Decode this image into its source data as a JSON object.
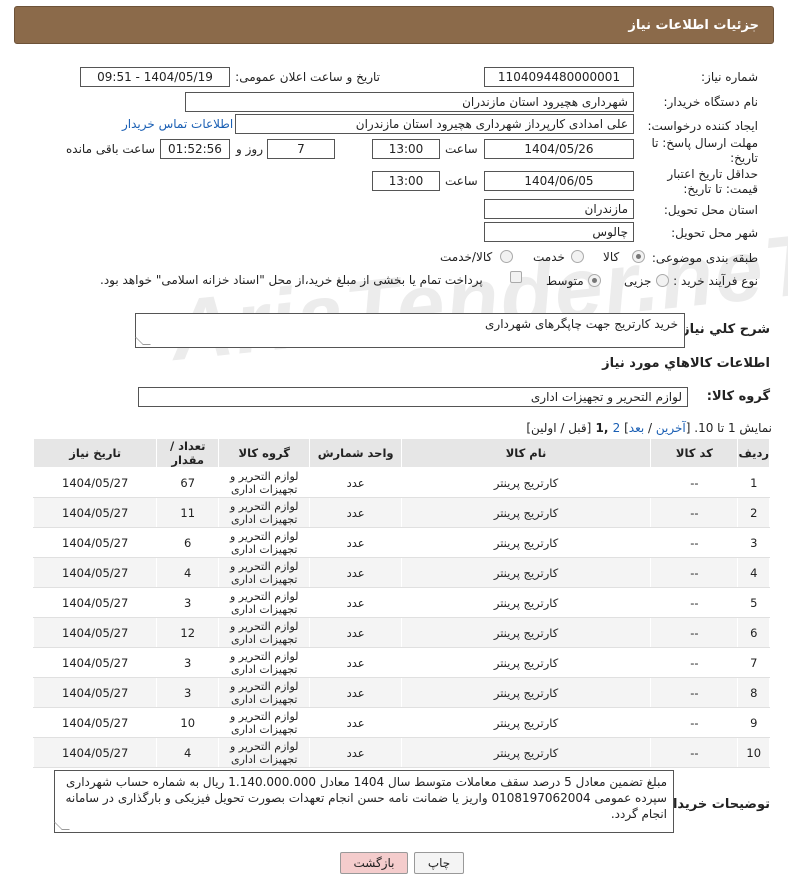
{
  "header": {
    "title": "جزئیات اطلاعات نیاز"
  },
  "watermark": "AriaTender.neT",
  "fields": {
    "need_number_label": "شماره نیاز:",
    "need_number": "1104094480000001",
    "announce_label": "تاریخ و ساعت اعلان عمومی:",
    "announce_value": "1404/05/19 - 09:51",
    "buyer_org_label": "نام دستگاه خریدار:",
    "buyer_org": "شهرداری هچیرود استان مازندران",
    "requester_label": "ایجاد کننده درخواست:",
    "requester": "علی امدادی کارپرداز شهرداری هچیرود استان مازندران",
    "buyer_contact_link": "اطلاعات تماس خریدار",
    "deadline_label": "مهلت ارسال پاسخ: تا تاریخ:",
    "deadline_date": "1404/05/26",
    "hour_label": "ساعت",
    "deadline_time": "13:00",
    "days_value": "7",
    "days_label": "روز و",
    "remaining_time": "01:52:56",
    "remaining_label": "ساعت باقی مانده",
    "price_validity_label": "حداقل تاریخ اعتبار قیمت: تا تاریخ:",
    "price_validity_date": "1404/06/05",
    "price_validity_time": "13:00",
    "province_label": "استان محل تحویل:",
    "province": "مازندران",
    "city_label": "شهر محل تحویل:",
    "city": "چالوس",
    "category_label": "طبقه بندی موضوعی:",
    "category_options": [
      "کالا",
      "خدمت",
      "کالا/خدمت"
    ],
    "purchase_type_label": "نوع فرآیند خرید :",
    "purchase_options": [
      "جزیی",
      "متوسط"
    ],
    "payment_note": "پرداخت تمام یا بخشی از مبلغ خرید،از محل \"اسناد خزانه اسلامی\" خواهد بود."
  },
  "description": {
    "label": "شرح کلي نياز:",
    "value": "خرید کارتریج جهت چاپگرهای شهرداری"
  },
  "goods_section_title": "اطلاعات کالاهاي مورد نياز",
  "goods_group": {
    "label": "گروه کالا:",
    "value": "لوازم التحرير و تجهيزات اداری"
  },
  "pagination": {
    "prefix": "نمایش 1 تا 10. [",
    "last": "آخرین",
    "sep1": " / ",
    "next": "بعد",
    "pages_open": "] ",
    "page2": "2",
    "current": " ,1 ",
    "suffix": "[قبل / اولین]"
  },
  "table": {
    "headers": [
      "ردیف",
      "کد کالا",
      "نام کالا",
      "واحد شمارش",
      "گروه کالا",
      "تعداد / مقدار",
      "تاریخ نیاز"
    ],
    "rows": [
      [
        "1",
        "--",
        "کارتریج پرینتر",
        "عدد",
        "لوازم التحرير و تجهيزات اداری",
        "67",
        "1404/05/27"
      ],
      [
        "2",
        "--",
        "کارتریج پرینتر",
        "عدد",
        "لوازم التحرير و تجهيزات اداری",
        "11",
        "1404/05/27"
      ],
      [
        "3",
        "--",
        "کارتریج پرینتر",
        "عدد",
        "لوازم التحرير و تجهيزات اداری",
        "6",
        "1404/05/27"
      ],
      [
        "4",
        "--",
        "کارتریج پرینتر",
        "عدد",
        "لوازم التحرير و تجهيزات اداری",
        "4",
        "1404/05/27"
      ],
      [
        "5",
        "--",
        "کارتریج پرینتر",
        "عدد",
        "لوازم التحرير و تجهيزات اداری",
        "3",
        "1404/05/27"
      ],
      [
        "6",
        "--",
        "کارتریج پرینتر",
        "عدد",
        "لوازم التحرير و تجهيزات اداری",
        "12",
        "1404/05/27"
      ],
      [
        "7",
        "--",
        "کارتریج پرینتر",
        "عدد",
        "لوازم التحرير و تجهيزات اداری",
        "3",
        "1404/05/27"
      ],
      [
        "8",
        "--",
        "کارتریج پرینتر",
        "عدد",
        "لوازم التحرير و تجهيزات اداری",
        "3",
        "1404/05/27"
      ],
      [
        "9",
        "--",
        "کارتریج پرینتر",
        "عدد",
        "لوازم التحرير و تجهيزات اداری",
        "10",
        "1404/05/27"
      ],
      [
        "10",
        "--",
        "کارتریج پرینتر",
        "عدد",
        "لوازم التحرير و تجهيزات اداری",
        "4",
        "1404/05/27"
      ]
    ]
  },
  "buyer_notes": {
    "label": "توضیحات خریدار:",
    "value": "مبلغ تضمین معادل 5 درصد سقف معاملات متوسط سال 1404 معادل 1.140.000.000 ریال به شماره حساب شهرداری سپرده عمومی 0108197062004 واریز یا ضمانت نامه حسن انجام تعهدات بصورت تحویل فیزیکی و بارگذاری در سامانه انجام گردد."
  },
  "buttons": {
    "print": "چاپ",
    "back": "بازگشت"
  },
  "colors": {
    "header": "#8b6a4a",
    "back_button": "#f4cccc",
    "link": "#1a5fb4"
  }
}
